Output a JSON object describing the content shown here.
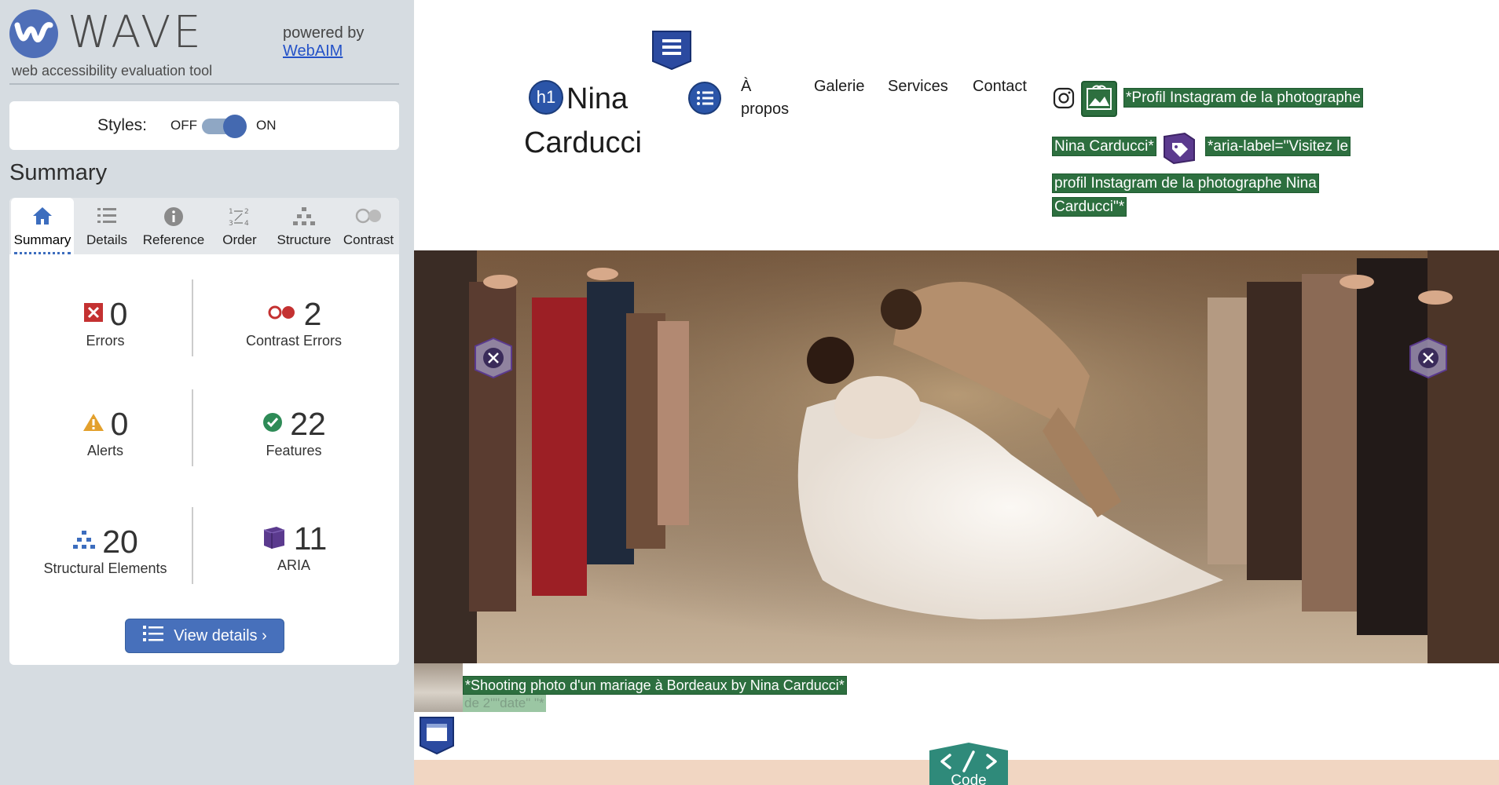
{
  "wave": {
    "logo_word": "WAVE",
    "tagline": "web accessibility evaluation tool",
    "powered_by": "powered by",
    "powered_link": "WebAIM",
    "styles_label": "Styles:",
    "toggle_off": "OFF",
    "toggle_on": "ON",
    "summary_title": "Summary",
    "tabs": [
      {
        "label": "Summary",
        "icon": "home-icon",
        "active": true
      },
      {
        "label": "Details",
        "icon": "list-icon",
        "active": false
      },
      {
        "label": "Reference",
        "icon": "info-icon",
        "active": false
      },
      {
        "label": "Order",
        "icon": "order-icon",
        "active": false
      },
      {
        "label": "Structure",
        "icon": "structure-icon",
        "active": false
      },
      {
        "label": "Contrast",
        "icon": "contrast-icon",
        "active": false
      }
    ],
    "stats": {
      "errors": {
        "value": "0",
        "label": "Errors",
        "icon": "error-icon"
      },
      "contrast_errors": {
        "value": "2",
        "label": "Contrast Errors",
        "icon": "contrast-error-icon"
      },
      "alerts": {
        "value": "0",
        "label": "Alerts",
        "icon": "alert-icon"
      },
      "features": {
        "value": "22",
        "label": "Features",
        "icon": "feature-check-icon"
      },
      "structural": {
        "value": "20",
        "label": "Structural Elements",
        "icon": "structure-icon"
      },
      "aria": {
        "value": "11",
        "label": "ARIA",
        "icon": "aria-cube-icon"
      }
    },
    "view_details": "View details ›",
    "colors": {
      "accent": "#4770bb",
      "panel_bg": "#d6dce1",
      "error": "#c0392b",
      "alert": "#e0a030",
      "feature": "#2e8b57",
      "aria": "#5b3a8e"
    }
  },
  "page": {
    "brand_h1_badge": "h1",
    "brand_line1": "Nina",
    "brand_line2": "Carducci",
    "nav": {
      "about_line1": "À",
      "about_line2": "propos",
      "gallery": "Galerie",
      "services": "Services",
      "contact": "Contact"
    },
    "social": {
      "alt_line1": "*Profil Instagram de la photographe",
      "alt_line2": "Nina Carducci*",
      "aria_line1": "*aria-label=\"Visitez le",
      "aria_line2": "profil Instagram de la photographe Nina",
      "aria_line3": "Carducci\"*"
    },
    "caption": "*Shooting photo d'un mariage à Bordeaux by Nina Carducci*",
    "caption_ghost": "de 2\"\"date\" \"*",
    "code_badge": "Code",
    "colors": {
      "highlight": "#2d6f3f",
      "footer": "#f1d6c2",
      "code_badge": "#2f8a7a"
    }
  }
}
